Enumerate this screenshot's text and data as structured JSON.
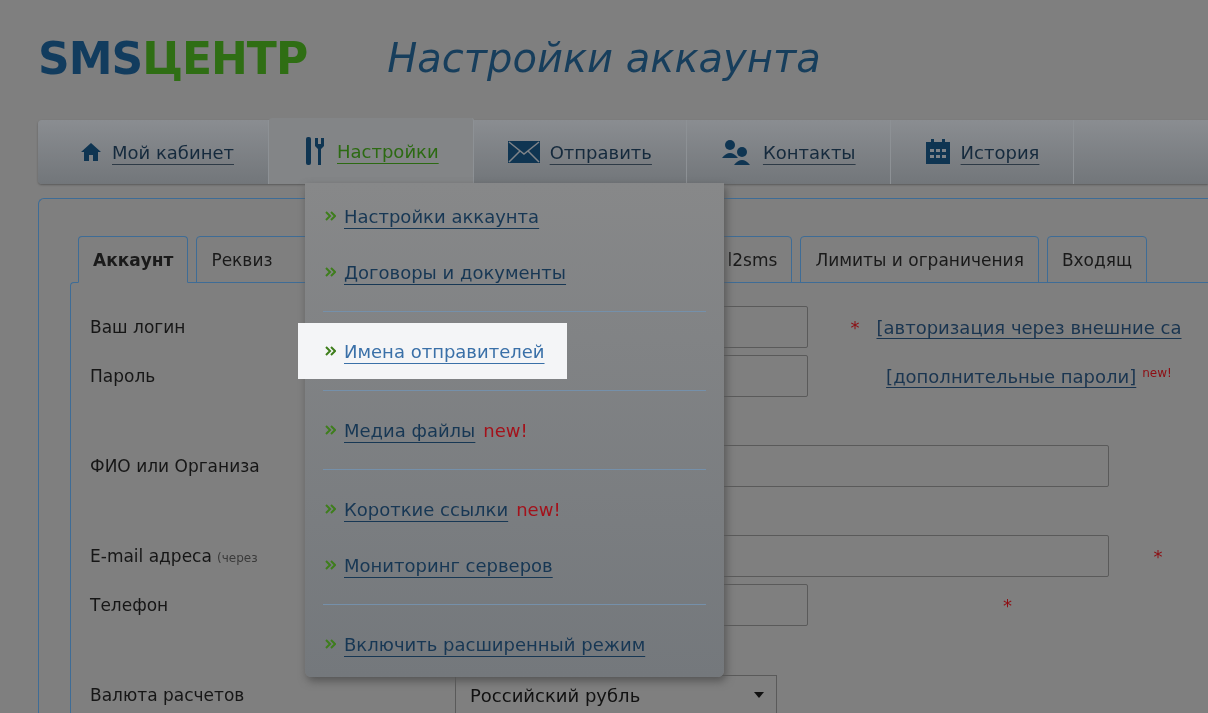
{
  "logo": {
    "part_1": "SMS",
    "part_2": "ЦЕНТР"
  },
  "page_title": "Настройки аккаунта",
  "nav": [
    {
      "label": "Мой кабинет",
      "selected": false
    },
    {
      "label": "Настройки",
      "selected": true
    },
    {
      "label": "Отправить",
      "selected": false
    },
    {
      "label": "Контакты",
      "selected": false
    },
    {
      "label": "История",
      "selected": false
    }
  ],
  "subtabs": [
    {
      "label": "Аккаунт",
      "selected": true
    },
    {
      "label": "Реквиз",
      "selected": false
    },
    {
      "label": "l2sms",
      "selected": false
    },
    {
      "label": "Лимиты и ограничения",
      "selected": false
    },
    {
      "label": "Входящ",
      "selected": false
    }
  ],
  "form": {
    "sections": [
      [
        {
          "label": "Ваш логин",
          "kind": "short",
          "mark": "*",
          "link": "[авторизация через внешние са"
        },
        {
          "label": "Пароль",
          "kind": "short",
          "link": "[дополнительные пароли]",
          "link_badge": "new!"
        }
      ],
      [
        {
          "label": "ФИО или Организа",
          "kind": "long"
        }
      ],
      [
        {
          "label": "E-mail адреса",
          "note": "(через",
          "kind": "long",
          "mark": "*"
        },
        {
          "label": "Телефон",
          "kind": "short",
          "mark": "*"
        }
      ],
      [
        {
          "label": "Валюта расчетов",
          "kind": "select",
          "value": "Российский рубль"
        }
      ]
    ]
  },
  "menu": {
    "groups": [
      [
        {
          "label": "Настройки аккаунта",
          "selected": false
        },
        {
          "label": "Договоры и документы",
          "selected": false
        }
      ],
      [
        {
          "label": "Имена отправителей",
          "selected": true
        }
      ],
      [
        {
          "label": "Медиа файлы",
          "badge": "new!",
          "selected": false
        }
      ],
      [
        {
          "label": "Короткие ссылки",
          "badge": "new!",
          "selected": false
        },
        {
          "label": "Мониторинг серверов",
          "selected": false
        }
      ],
      [
        {
          "label": "Включить расширенный режим",
          "selected": false
        }
      ]
    ]
  }
}
